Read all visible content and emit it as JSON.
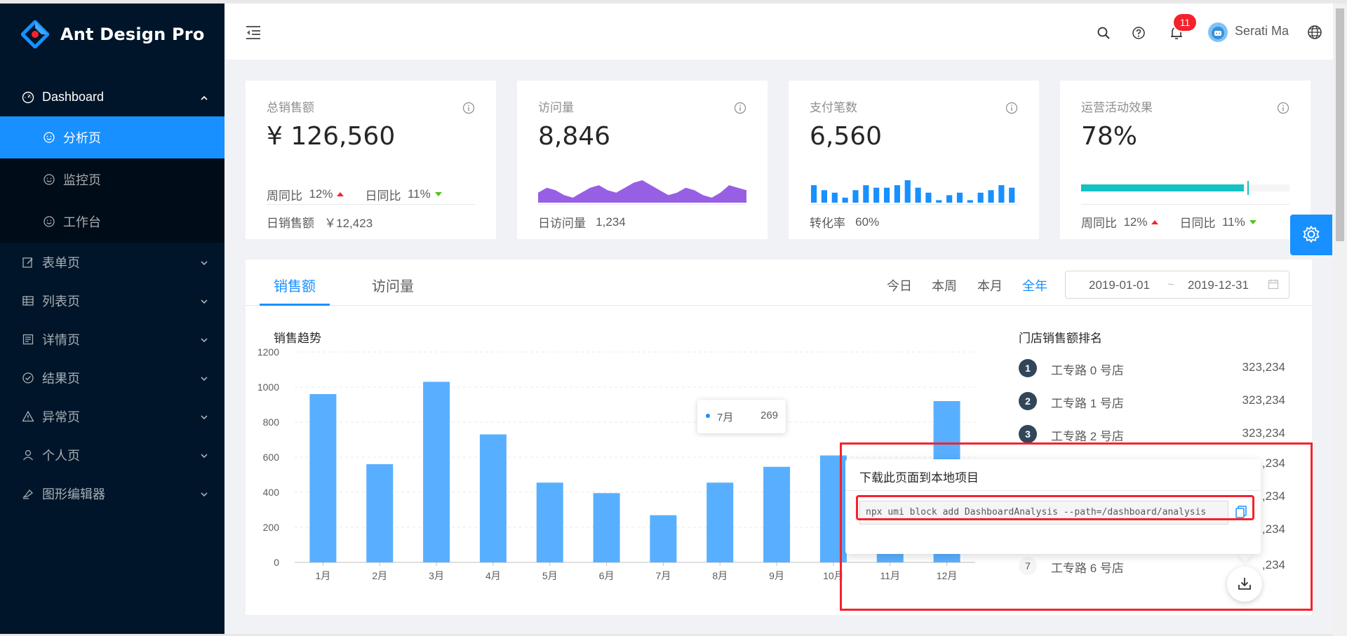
{
  "app": {
    "title": "Ant Design Pro"
  },
  "sidebar": {
    "dashboard": {
      "label": "Dashboard"
    },
    "sub": [
      {
        "label": "分析页"
      },
      {
        "label": "监控页"
      },
      {
        "label": "工作台"
      }
    ],
    "items": [
      {
        "label": "表单页"
      },
      {
        "label": "列表页"
      },
      {
        "label": "详情页"
      },
      {
        "label": "结果页"
      },
      {
        "label": "异常页"
      },
      {
        "label": "个人页"
      },
      {
        "label": "图形编辑器"
      }
    ]
  },
  "header": {
    "notifications_count": "11",
    "username": "Serati Ma"
  },
  "stats": {
    "sales": {
      "label": "总销售额",
      "value": "¥ 126,560",
      "week_label": "周同比",
      "week_value": "12%",
      "day_label": "日同比",
      "day_value": "11%",
      "footer_label": "日销售额",
      "footer_value": "￥12,423"
    },
    "visits": {
      "label": "访问量",
      "value": "8,846",
      "footer_label": "日访问量",
      "footer_value": "1,234"
    },
    "payments": {
      "label": "支付笔数",
      "value": "6,560",
      "footer_label": "转化率",
      "footer_value": "60%"
    },
    "ops": {
      "label": "运营活动效果",
      "value": "78%",
      "progress": 0.78,
      "target": 0.8,
      "week_label": "周同比",
      "week_value": "12%",
      "day_label": "日同比",
      "day_value": "11%"
    }
  },
  "tabs": {
    "sales": "销售额",
    "visits": "访问量"
  },
  "ranges": {
    "today": "今日",
    "week": "本周",
    "month": "本月",
    "year": "全年"
  },
  "datepicker": {
    "start": "2019-01-01",
    "sep": "~",
    "end": "2019-12-31"
  },
  "trend_title": "销售趋势",
  "ranking": {
    "title": "门店销售额排名",
    "items": [
      {
        "rank": "1",
        "name": "工专路 0 号店",
        "value": "323,234"
      },
      {
        "rank": "2",
        "name": "工专路 1 号店",
        "value": "323,234"
      },
      {
        "rank": "3",
        "name": "工专路 2 号店",
        "value": "323,234"
      },
      {
        "rank": "7",
        "name": "工专路 6 号店",
        "value": ",234"
      }
    ],
    "extra_values": [
      ",234",
      ",234",
      ",234"
    ]
  },
  "tooltip": {
    "label": "7月",
    "value": "269"
  },
  "popover": {
    "title": "下载此页面到本地项目",
    "command": "npx umi block add DashboardAnalysis --path=/dashboard/analysis"
  },
  "chart_data": {
    "type": "bar",
    "categories": [
      "1月",
      "2月",
      "3月",
      "4月",
      "5月",
      "6月",
      "7月",
      "8月",
      "9月",
      "10月",
      "11月",
      "12月"
    ],
    "values": [
      960,
      560,
      1030,
      730,
      455,
      395,
      269,
      455,
      545,
      610,
      560,
      920
    ],
    "ylim": [
      0,
      1200
    ],
    "yticks": [
      0,
      200,
      400,
      600,
      800,
      1000,
      1200
    ],
    "color": "#58afff"
  },
  "mini_visits": [
    4,
    6,
    5,
    3,
    2,
    4,
    6,
    7,
    5,
    4,
    6,
    8,
    9,
    7,
    5,
    3,
    4,
    6,
    5,
    3,
    2,
    4,
    7,
    6,
    5
  ],
  "mini_payments": [
    7,
    5,
    4,
    2,
    5,
    7,
    6,
    6,
    7,
    9,
    6,
    4,
    1,
    3,
    4,
    1,
    4,
    5,
    7,
    6
  ],
  "colors": {
    "primary": "#1890ff",
    "sider": "#001529",
    "area": "#975fe4",
    "progress": "#13c2c2",
    "up": "#f5222d",
    "down": "#52c41a"
  }
}
